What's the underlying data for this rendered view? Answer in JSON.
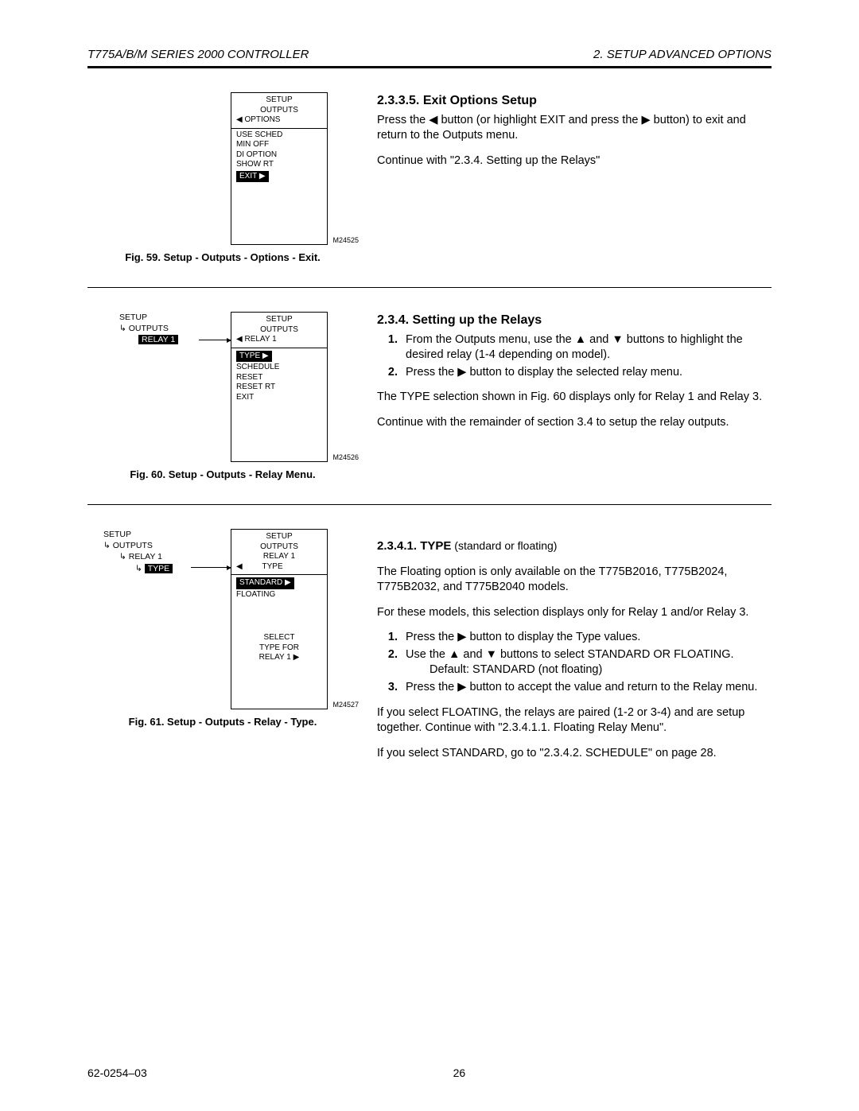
{
  "header": {
    "left": "T775A/B/M SERIES 2000 CONTROLLER",
    "right": "2. SETUP ADVANCED OPTIONS"
  },
  "footer": {
    "docnum": "62-0254–03",
    "pagenum": "26"
  },
  "sec1": {
    "title": "2.3.3.5. Exit Options Setup",
    "p1a": "Press the ",
    "p1b": " button (or highlight EXIT and press the ",
    "p1c": " button) to exit and return to the Outputs menu.",
    "p2": "Continue with \"2.3.4. Setting up the Relays\"",
    "left_arrow": "◀",
    "right_arrow": "▶",
    "fig": {
      "head1": "SETUP",
      "head2": "OUTPUTS",
      "head3": "◀ OPTIONS",
      "items": [
        "USE SCHED",
        "MIN OFF",
        "DI OPTION",
        "SHOW RT"
      ],
      "exit": "EXIT ▶",
      "id": "M24525",
      "caption": "Fig. 59. Setup - Outputs - Options - Exit."
    }
  },
  "sec2": {
    "title": "2.3.4. Setting up the Relays",
    "li1a": "From the Outputs menu, use the ",
    "li1b": " and ",
    "li1c": " buttons to highlight the desired relay (1-4 depending on model).",
    "li2a": "Press the ",
    "li2b": " button to display the selected relay menu.",
    "up": "▲",
    "down": "▼",
    "right_arrow": "▶",
    "p1": "The TYPE selection shown in Fig. 60 displays only for Relay 1 and Relay 3.",
    "p2": "Continue with the remainder of section 3.4 to setup the relay outputs.",
    "tree": {
      "l1": "SETUP",
      "l2": "OUTPUTS",
      "l3": "RELAY 1",
      "elbow": "↳"
    },
    "fig": {
      "head1": "SETUP",
      "head2": "OUTPUTS",
      "head3": "◀ RELAY 1",
      "type": "TYPE ▶",
      "items": [
        "SCHEDULE",
        "RESET",
        "RESET RT",
        "EXIT"
      ],
      "id": "M24526",
      "caption": "Fig. 60. Setup - Outputs - Relay Menu."
    }
  },
  "sec3": {
    "title": "2.3.4.1. TYPE",
    "subtitle": " (standard or floating)",
    "p1": "The Floating option is only available on the T775B2016, T775B2024, T775B2032, and T775B2040 models.",
    "p2": "For these models, this selection displays only for Relay 1 and/or Relay 3.",
    "li1a": "Press the ",
    "li1b": " button to display the Type values.",
    "li2a": "Use the ",
    "li2b": " and ",
    "li2c": " buttons to select STANDARD OR FLOATING.",
    "li2d": "Default: STANDARD (not floating)",
    "li3a": "Press the ",
    "li3b": " button to accept the value and return to the Relay menu.",
    "up": "▲",
    "down": "▼",
    "right_arrow": "▶",
    "p3": "If you select FLOATING, the relays are paired (1-2 or 3-4) and are setup together. Continue with \"2.3.4.1.1. Floating Relay Menu\".",
    "p4": "If you select STANDARD, go to \"2.3.4.2. SCHEDULE\" on page 28.",
    "tree": {
      "l1": "SETUP",
      "l2": "OUTPUTS",
      "l3": "RELAY 1",
      "l4": "TYPE",
      "elbow": "↳"
    },
    "fig": {
      "head1": "SETUP",
      "head2": "OUTPUTS",
      "head3": "RELAY 1",
      "head4": "◀         TYPE",
      "standard": "STANDARD  ▶",
      "floating": "FLOATING",
      "foot1": "SELECT",
      "foot2": "TYPE FOR",
      "foot3": "RELAY 1 ▶",
      "id": "M24527",
      "caption": "Fig. 61. Setup - Outputs - Relay - Type."
    }
  }
}
